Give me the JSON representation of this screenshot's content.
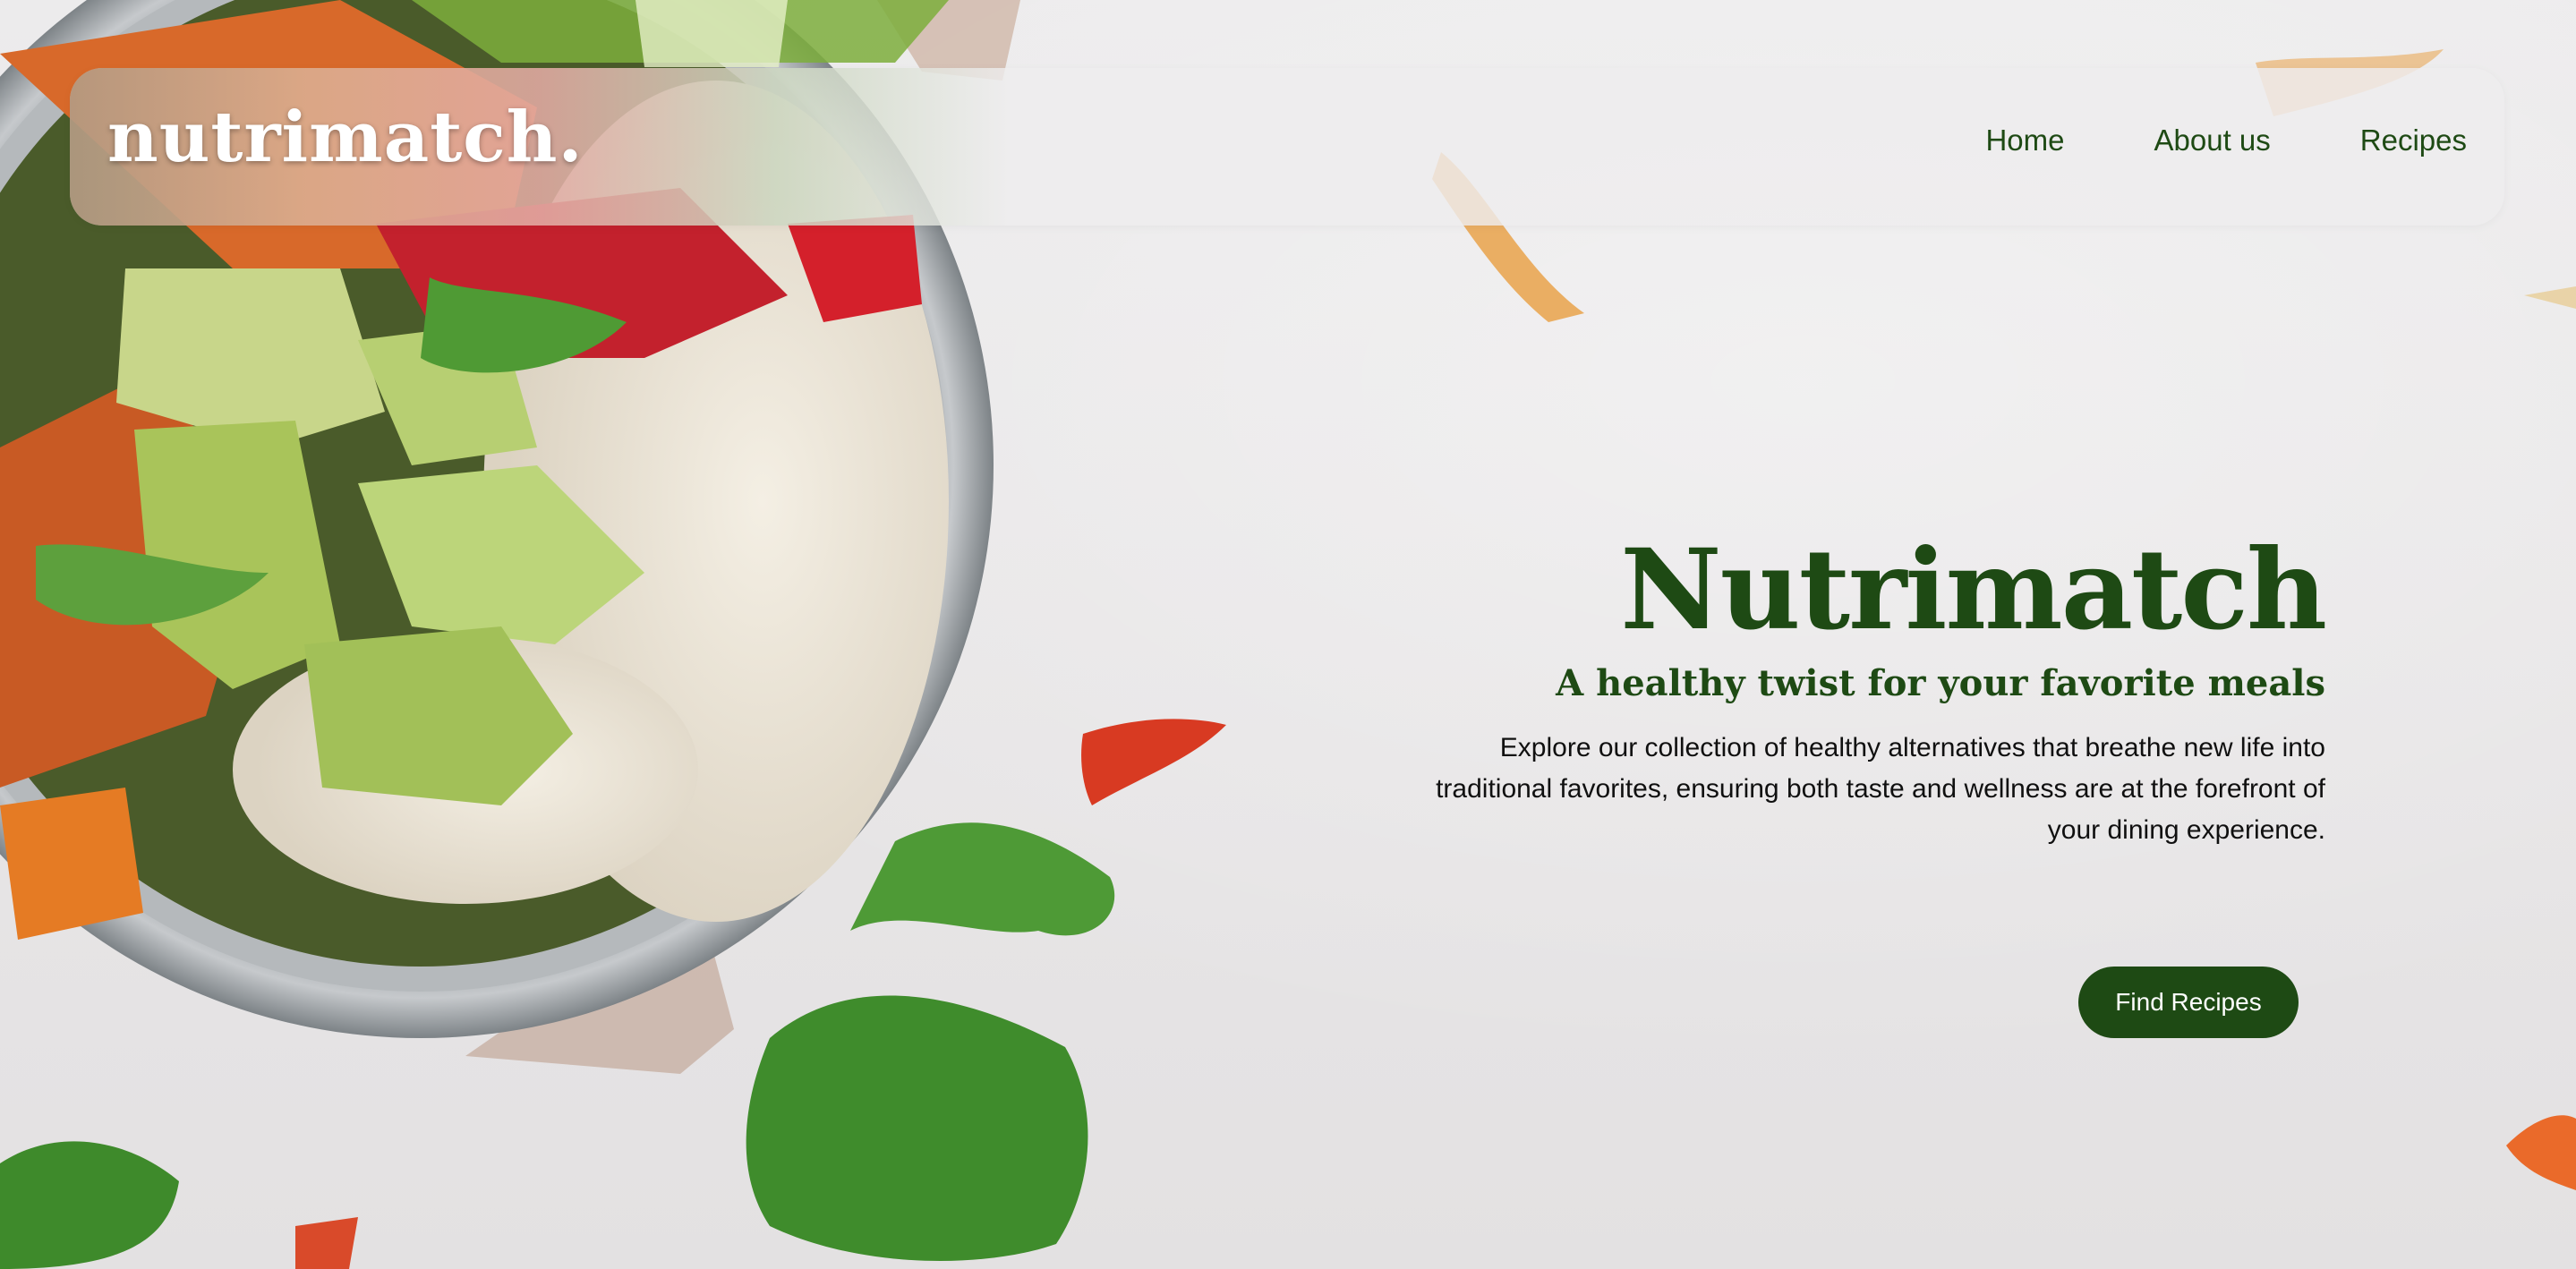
{
  "brand": {
    "logo_text": "nutrimatch.",
    "accent_color": "#1e4a14"
  },
  "nav": {
    "items": [
      {
        "label": "Home"
      },
      {
        "label": "About us"
      },
      {
        "label": "Recipes"
      }
    ]
  },
  "hero": {
    "title": "Nutrimatch",
    "subtitle": "A healthy twist for your favorite meals",
    "description": "Explore our collection of healthy alternatives that breathe new life into traditional favorites, ensuring both taste and wellness are at the forefront of your dining experience.",
    "cta_label": "Find Recipes"
  },
  "background": {
    "image_description": "bowl-of-rice-avocado-vegetables-image"
  }
}
